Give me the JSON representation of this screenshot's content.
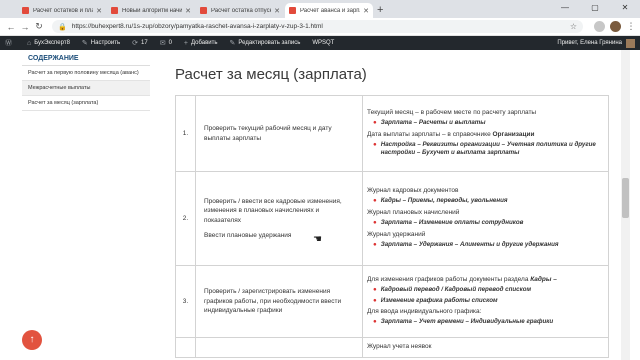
{
  "browser": {
    "tabs": [
      {
        "title": "Расчет остатков и планирован",
        "active": false
      },
      {
        "title": "Новый алгоритм начисления",
        "active": false
      },
      {
        "title": "Расчет остатка отпуска за рабо",
        "active": false
      },
      {
        "title": "Расчет аванса и зарплаты в ЗУП",
        "active": true
      }
    ],
    "new_tab": "+",
    "window_controls": {
      "minimize": "—",
      "maximize": "▢",
      "close": "✕"
    },
    "url": "https://buhexpert8.ru/1s-zup/obzory/pamyatka-raschet-avansa-i-zarplaty-v-zup-3-1.html"
  },
  "admin_bar": {
    "site_name": "БухЭксперт8",
    "customize": "Настроить",
    "comments_count": "17",
    "updates_count": "0",
    "add": "Добавить",
    "edit": "Редактировать запись",
    "plugin": "WPSQT",
    "greeting": "Привет, Елена Грянина"
  },
  "sidebar": {
    "title": "СОДЕРЖАНИЕ",
    "items": [
      {
        "label": "Расчет за первую половину месяца (аванс)",
        "highlight": false
      },
      {
        "label": "Межрасчетные выплаты",
        "highlight": true
      },
      {
        "label": "Расчет за месяц (зарплата)",
        "highlight": false
      }
    ]
  },
  "main": {
    "title": "Расчет за месяц (зарплата)",
    "rows": [
      {
        "num": "1.",
        "action": "Проверить текущий рабочий месяц и дату выплаты зарплаты",
        "d1": "Текущий месяц – в рабочем месте по расчету зарплаты",
        "d1b1": "Зарплата – Расчеты и выплаты",
        "d2": "Дата выплаты зарплаты – в справочнике ",
        "d2strong": "Организации",
        "d2b1": "Настройка – Реквизиты организации – Учетная политика и другие настройки – Бухучет и выплата зарплаты"
      },
      {
        "num": "2.",
        "action": "Проверить / ввести все кадровые изменения, изменения в плановых начислениях и показателях",
        "action2": "Ввести плановые удержания",
        "d1": "Журнал кадровых документов",
        "d1b1": "Кадры – Приемы, переводы, увольнения",
        "d2": "Журнал плановых начислений",
        "d2b1": "Зарплата – Изменение оплаты сотрудников",
        "d3": "Журнал удержаний",
        "d3b1": "Зарплата – Удержания – Алименты и другие удержания"
      },
      {
        "num": "3.",
        "action": "Проверить / зарегистрировать изменения графиков работы, при необходимости ввести индивидуальные графики",
        "d1": "Для изменения графиков работы документы раздела ",
        "d1strong": "Кадры –",
        "d1b1": "Кадровый перевод / Кадровый перевод списком",
        "d1b2": "Изменение графика работы списком",
        "d2": "Для ввода индивидуального графика:",
        "d2b1": "Зарплата – Учет времени – Индивидуальные графики"
      },
      {
        "d1": "Журнал учета неявок"
      }
    ]
  },
  "up_button": "↑"
}
